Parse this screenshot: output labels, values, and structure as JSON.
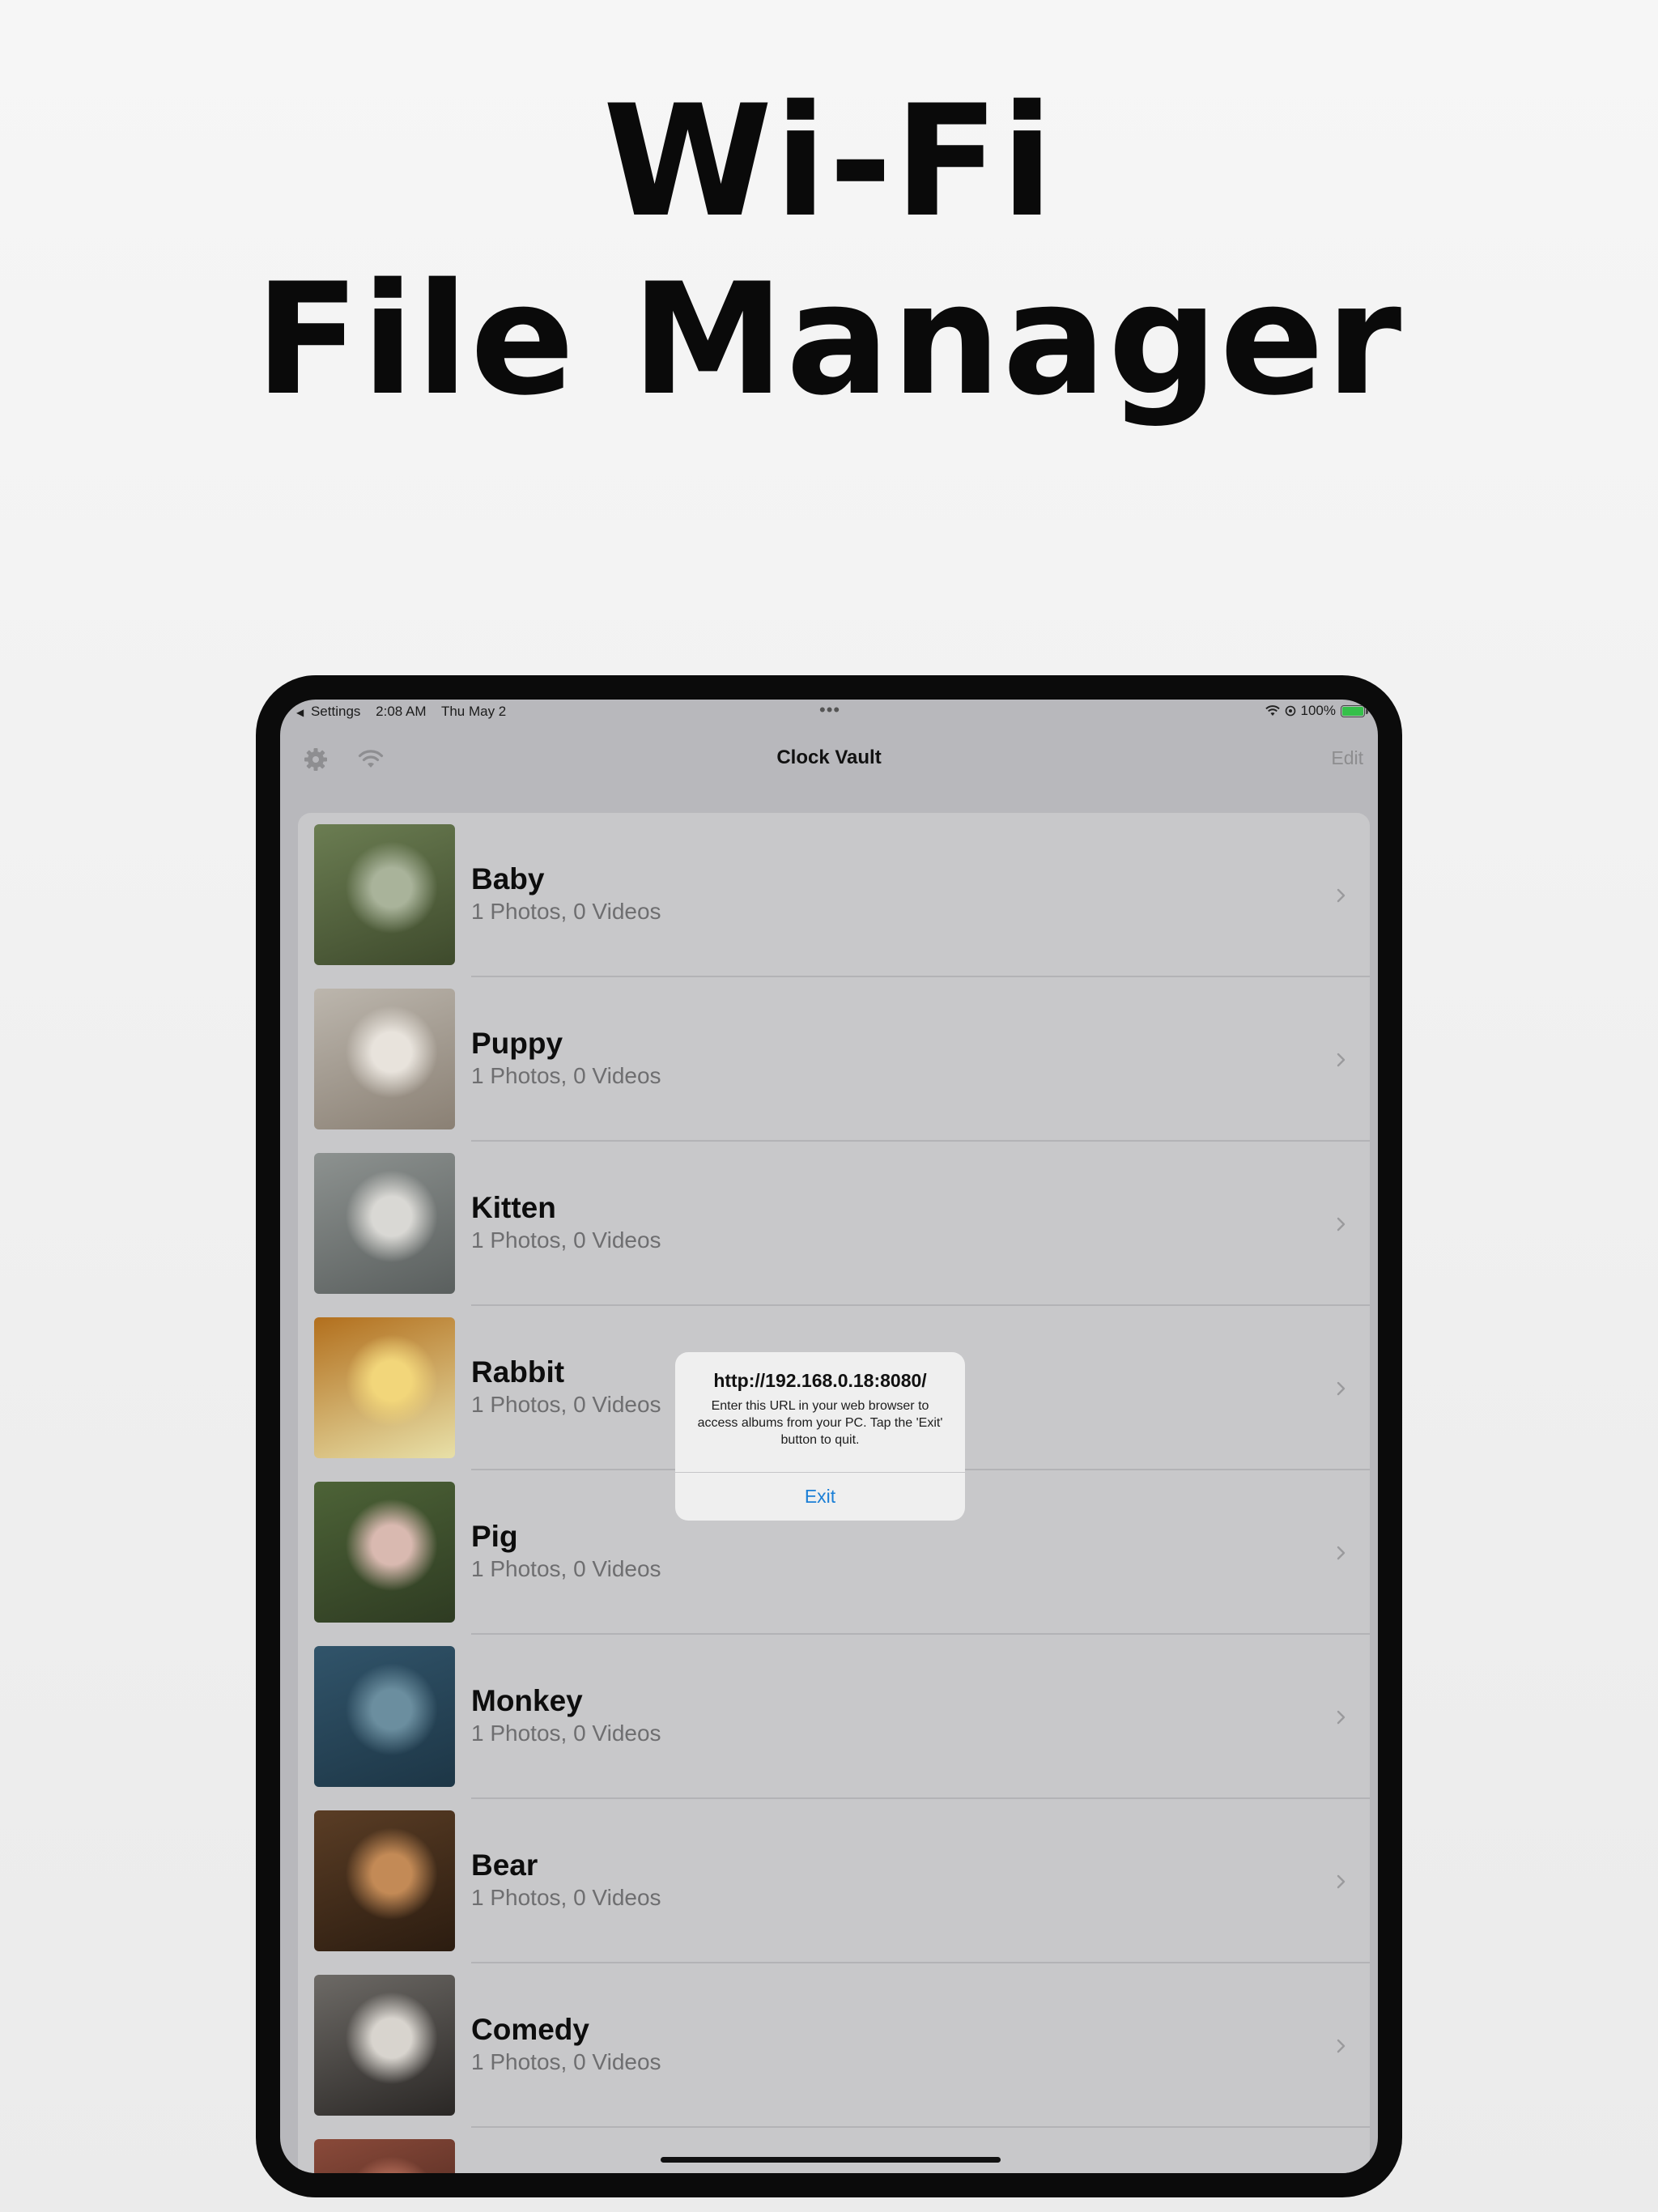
{
  "headline": {
    "line1": "Wi-Fi",
    "line2": "File Manager"
  },
  "status_bar": {
    "back_label": "Settings",
    "time": "2:08 AM",
    "date": "Thu May 2",
    "battery": "100%",
    "battery_level": 1.0,
    "icons": [
      "wifi-icon",
      "location-icon",
      "battery-charging-icon"
    ]
  },
  "nav": {
    "title": "Clock Vault",
    "edit_label": "Edit",
    "left_icons": [
      "gear-icon",
      "wifi-icon"
    ]
  },
  "albums": [
    {
      "name": "Baby",
      "count": "1 Photos, 0 Videos",
      "thumb_colors": [
        "#6b7d52",
        "#a9b39a",
        "#3e4a2c"
      ]
    },
    {
      "name": "Puppy",
      "count": "1 Photos, 0 Videos",
      "thumb_colors": [
        "#bcb6ad",
        "#e8e3dc",
        "#8a8074"
      ]
    },
    {
      "name": "Kitten",
      "count": "1 Photos, 0 Videos",
      "thumb_colors": [
        "#8d9290",
        "#d9d8d4",
        "#5a5f5e"
      ]
    },
    {
      "name": "Rabbit",
      "count": "1 Photos, 0 Videos",
      "thumb_colors": [
        "#b26f1d",
        "#f2d67a",
        "#e8e0a8"
      ]
    },
    {
      "name": "Pig",
      "count": "1 Photos, 0 Videos",
      "thumb_colors": [
        "#4d6337",
        "#d9b9b0",
        "#2e3b22"
      ]
    },
    {
      "name": "Monkey",
      "count": "1 Photos, 0 Videos",
      "thumb_colors": [
        "#31546a",
        "#6b8e9f",
        "#1d3646"
      ]
    },
    {
      "name": "Bear",
      "count": "1 Photos, 0 Videos",
      "thumb_colors": [
        "#5a3d25",
        "#c38a56",
        "#2b1c10"
      ]
    },
    {
      "name": "Comedy",
      "count": "1 Photos, 0 Videos",
      "thumb_colors": [
        "#6d6a66",
        "#d8d4ce",
        "#2a2725"
      ]
    },
    {
      "name": "",
      "count": "",
      "thumb_colors": [
        "#8a4a3a",
        "#c77a64",
        "#3d1f18"
      ]
    }
  ],
  "alert": {
    "title": "http://192.168.0.18:8080/",
    "message": "Enter this URL in your web browser to access albums from your PC. Tap the 'Exit' button to quit.",
    "button": "Exit"
  },
  "colors": {
    "accent": "#1b7fd6",
    "battery_green": "#35c04a"
  }
}
